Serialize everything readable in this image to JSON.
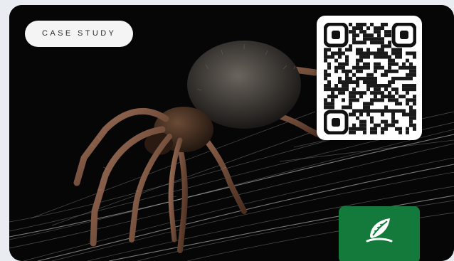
{
  "card": {
    "badge_label": "CASE STUDY",
    "image_subject": "orb-weaver-spider-on-web",
    "qr_icon": "qr-code-icon",
    "logo_icon": "leaf-brand-logo-icon",
    "colors": {
      "background": "#e9edf2",
      "photo_background": "#060606",
      "badge_background": "#f4f4f4",
      "badge_text": "#2b2b2b",
      "logo_tile": "#137a3b"
    }
  }
}
